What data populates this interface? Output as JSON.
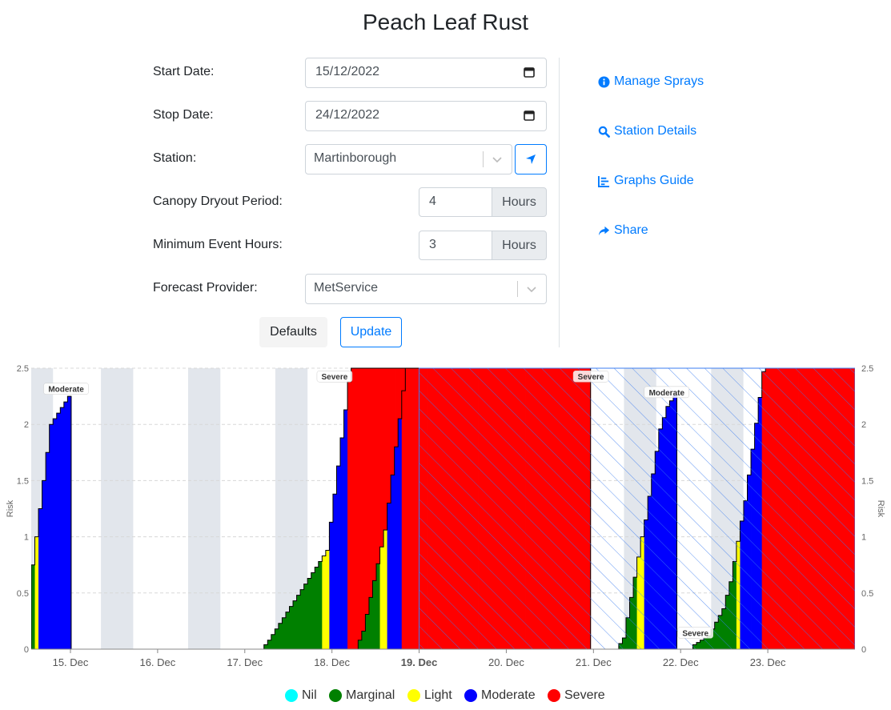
{
  "page_title": "Peach Leaf Rust",
  "form": {
    "start_date": {
      "label": "Start Date:",
      "value": "15/12/2022"
    },
    "stop_date": {
      "label": "Stop Date:",
      "value": "24/12/2022"
    },
    "station": {
      "label": "Station:",
      "value": "Martinborough"
    },
    "canopy": {
      "label": "Canopy Dryout Period:",
      "value": "4",
      "unit": "Hours"
    },
    "min_event": {
      "label": "Minimum Event Hours:",
      "value": "3",
      "unit": "Hours"
    },
    "forecast": {
      "label": "Forecast Provider:",
      "value": "MetService"
    },
    "defaults_label": "Defaults",
    "update_label": "Update"
  },
  "side_links": {
    "manage_sprays": "Manage Sprays",
    "station_details": "Station Details",
    "graphs_guide": "Graphs Guide",
    "share": "Share"
  },
  "colors": {
    "accent": "#007bff",
    "nil": "#00ffff",
    "marginal": "#008000",
    "light": "#ffff00",
    "moderate": "#0000ff",
    "severe": "#ff0000",
    "night_band": "#e2e6ec"
  },
  "chart_data": {
    "type": "area",
    "x_unit": "day (December 2022)",
    "xlim": [
      14.55,
      24.0
    ],
    "ylim": [
      0,
      2.5
    ],
    "ylabel": "Risk",
    "y_ticks": [
      "0",
      "0.5",
      "1",
      "1.5",
      "2",
      "2.5"
    ],
    "x_ticks": [
      {
        "x": 15,
        "label": "15. Dec",
        "bold": false
      },
      {
        "x": 16,
        "label": "16. Dec",
        "bold": false
      },
      {
        "x": 17,
        "label": "17. Dec",
        "bold": false
      },
      {
        "x": 18,
        "label": "18. Dec",
        "bold": false
      },
      {
        "x": 19,
        "label": "19. Dec",
        "bold": true
      },
      {
        "x": 20,
        "label": "20. Dec",
        "bold": false
      },
      {
        "x": 21,
        "label": "21. Dec",
        "bold": false
      },
      {
        "x": 22,
        "label": "22. Dec",
        "bold": false
      },
      {
        "x": 23,
        "label": "23. Dec",
        "bold": false
      }
    ],
    "night_bands": [
      [
        14.55,
        14.8
      ],
      [
        15.35,
        15.72
      ],
      [
        16.35,
        16.72
      ],
      [
        17.35,
        17.72
      ],
      [
        18.35,
        18.72
      ],
      [
        19.35,
        19.72
      ],
      [
        20.35,
        20.72
      ],
      [
        21.35,
        21.72
      ],
      [
        22.35,
        22.72
      ],
      [
        23.35,
        23.72
      ]
    ],
    "forecast_region": [
      19.0,
      24.0
    ],
    "series": [
      {
        "name": "Nil",
        "values": []
      },
      {
        "name": "Marginal",
        "color": "#008000"
      },
      {
        "name": "Light",
        "color": "#ffff00"
      },
      {
        "name": "Moderate",
        "color": "#0000ff"
      },
      {
        "name": "Severe",
        "color": "#ff0000"
      }
    ],
    "events": [
      {
        "start": 14.55,
        "hourly_risk": [
          0.75,
          1.0,
          1.25,
          1.5,
          1.75,
          2.0,
          2.05,
          2.1,
          2.15,
          2.2,
          2.25
        ]
      },
      {
        "start": 17.22,
        "hourly_risk": [
          0.04,
          0.08,
          0.13,
          0.18,
          0.23,
          0.28,
          0.33,
          0.38,
          0.43,
          0.48,
          0.53,
          0.58,
          0.63,
          0.68,
          0.73,
          0.78,
          0.83,
          0.88,
          1.13,
          1.38,
          1.63,
          1.88,
          2.13,
          2.38,
          2.63,
          2.88,
          3.13,
          3.38,
          3.63,
          3.88,
          4.13,
          4.38,
          4.63,
          4.88,
          5.13,
          5.38,
          5.63,
          5.88,
          6.13,
          6.38
        ]
      },
      {
        "start": 18.3,
        "hourly_risk": [
          0.08,
          0.16,
          0.31,
          0.46,
          0.61,
          0.76,
          0.91,
          1.06,
          1.3,
          1.55,
          1.8,
          2.05,
          2.3,
          2.55,
          2.8,
          3.05,
          3.3,
          3.55,
          3.8,
          4.05,
          4.3,
          4.55,
          4.8,
          5.05,
          5.3,
          5.55,
          5.8,
          6.05,
          6.3,
          6.55,
          6.8,
          7.05,
          7.3,
          7.55,
          7.8,
          8.05,
          8.3,
          8.55,
          8.8,
          9.05,
          9.3,
          9.55,
          9.8,
          10.05,
          10.3,
          10.55,
          10.8,
          11.05,
          11.3,
          11.55,
          11.8,
          12.05,
          12.3,
          12.55,
          12.8,
          13.05,
          13.3,
          13.55,
          13.8,
          14.05,
          14.3,
          14.55,
          14.8,
          15.05
        ]
      },
      {
        "start": 21.29,
        "hourly_risk": [
          0.05,
          0.1,
          0.28,
          0.46,
          0.64,
          0.82,
          1.0,
          1.15,
          1.36,
          1.56,
          1.76,
          1.96,
          2.06,
          2.16,
          2.21,
          2.26
        ]
      },
      {
        "start": 22.14,
        "hourly_risk": [
          0.04,
          0.06,
          0.08,
          0.1,
          0.12,
          0.18,
          0.24,
          0.3,
          0.36,
          0.48,
          0.6,
          0.78,
          0.96,
          1.14,
          1.32,
          1.55,
          1.78,
          2.01,
          2.24,
          2.47,
          2.7,
          2.93,
          3.16,
          3.39,
          3.62,
          3.85,
          4.08,
          4.31,
          4.54,
          4.77,
          5.0,
          5.23,
          5.46,
          5.69,
          5.92,
          6.15,
          6.38,
          6.61,
          6.84,
          7.07,
          7.3,
          7.53,
          7.76,
          7.99,
          8.22
        ]
      }
    ],
    "annotations": [
      {
        "x": 14.95,
        "y": 2.31,
        "text": "Moderate"
      },
      {
        "x": 18.03,
        "y": 2.42,
        "text": "Severe"
      },
      {
        "x": 20.97,
        "y": 2.42,
        "text": "Severe"
      },
      {
        "x": 21.84,
        "y": 2.28,
        "text": "Moderate"
      },
      {
        "x": 22.17,
        "y": 0.14,
        "text": "Severe"
      }
    ],
    "legend": [
      "Nil",
      "Marginal",
      "Light",
      "Moderate",
      "Severe"
    ],
    "legend_position": "bottom-center"
  }
}
